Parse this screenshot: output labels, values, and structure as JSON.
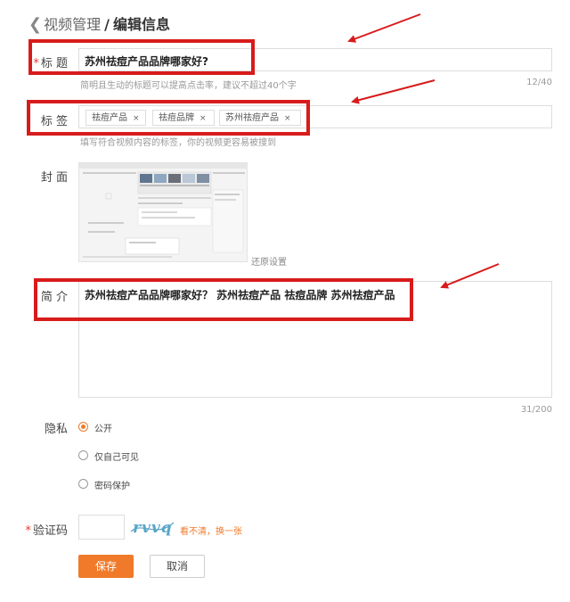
{
  "breadcrumb": {
    "back_icon": "chevron-left-icon",
    "parent": "视频管理",
    "separator": "/",
    "current": "编辑信息"
  },
  "form": {
    "required_mark": "*",
    "title": {
      "label": "标 题",
      "value": "苏州祛痘产品品牌哪家好?",
      "hint": "简明且生动的标题可以提高点击率，建议不超过40个字",
      "count": "12/40"
    },
    "tags": {
      "label": "标 签",
      "items": [
        {
          "text": "祛痘产品",
          "remove": "×"
        },
        {
          "text": "祛痘品牌",
          "remove": "×"
        },
        {
          "text": "苏州祛痘产品",
          "remove": "×"
        }
      ],
      "hint": "填写符合视频内容的标签，你的视频更容易被搜到"
    },
    "cover": {
      "label": "封 面",
      "reset": "还原设置"
    },
    "intro": {
      "label": "简 介",
      "value": "苏州祛痘产品品牌哪家好？ 苏州祛痘产品 祛痘品牌 苏州祛痘产品",
      "count": "31/200"
    },
    "privacy": {
      "label": "隐私",
      "options": [
        {
          "text": "公开",
          "selected": true
        },
        {
          "text": "仅自己可见",
          "selected": false
        },
        {
          "text": "密码保护",
          "selected": false
        }
      ]
    },
    "captcha": {
      "label": "验证码",
      "image_text": "rvvq",
      "refresh": "看不清，换一张"
    }
  },
  "buttons": {
    "save": "保存",
    "cancel": "取消"
  },
  "colors": {
    "accent": "#f07a2a",
    "annotation": "#d81b1b",
    "required": "#e53935",
    "captcha": "#5aa6c8"
  }
}
